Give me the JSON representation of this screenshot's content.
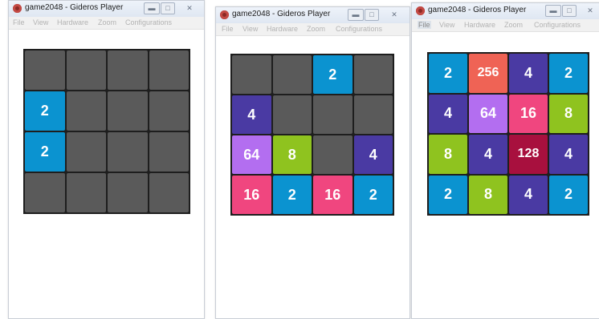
{
  "tile_colors": {
    "0": "#5a5a5a",
    "2": "#0b93d0",
    "4": "#4a3aa3",
    "8": "#8fc31f",
    "16": "#f0467f",
    "64": "#b36ef0",
    "128": "#a8103e",
    "256": "#ef6355"
  },
  "windows": [
    {
      "title": "game2048 - Gideros Player",
      "menu": [
        "File",
        "View",
        "Hardware",
        "Zoom",
        "Configurations"
      ],
      "board": [
        [
          0,
          0,
          0,
          0
        ],
        [
          2,
          0,
          0,
          0
        ],
        [
          2,
          0,
          0,
          0
        ],
        [
          0,
          0,
          0,
          0
        ]
      ]
    },
    {
      "title": "game2048 - Gideros Player",
      "menu": [
        "File",
        "View",
        "Hardware",
        "Zoom",
        "Configurations"
      ],
      "board": [
        [
          0,
          0,
          2,
          0
        ],
        [
          4,
          0,
          0,
          0
        ],
        [
          64,
          8,
          0,
          4
        ],
        [
          16,
          2,
          16,
          2
        ]
      ]
    },
    {
      "title": "game2048 - Gideros Player",
      "menu": [
        "File",
        "View",
        "Hardware",
        "Zoom",
        "Configurations"
      ],
      "board": [
        [
          2,
          256,
          4,
          2
        ],
        [
          4,
          64,
          16,
          8
        ],
        [
          8,
          4,
          128,
          4
        ],
        [
          2,
          8,
          4,
          2
        ]
      ]
    }
  ]
}
